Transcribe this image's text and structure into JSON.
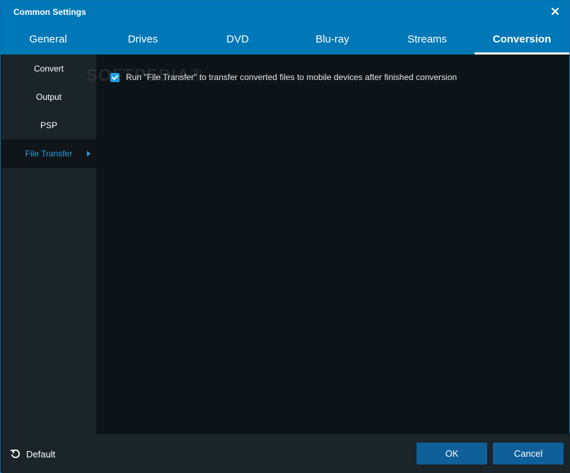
{
  "window": {
    "title": "Common Settings"
  },
  "tabs": [
    {
      "label": "General"
    },
    {
      "label": "Drives"
    },
    {
      "label": "DVD"
    },
    {
      "label": "Blu-ray"
    },
    {
      "label": "Streams"
    },
    {
      "label": "Conversion",
      "active": true
    }
  ],
  "sidebar": {
    "items": [
      {
        "label": "Convert"
      },
      {
        "label": "Output"
      },
      {
        "label": "PSP"
      },
      {
        "label": "File Transfer",
        "active": true
      }
    ]
  },
  "content": {
    "option_run_file_transfer": {
      "label": "Run \"File Transfer\" to transfer converted files to mobile devices after finished conversion",
      "checked": true
    },
    "watermark": "SOFTPEDIA®"
  },
  "footer": {
    "default_label": "Default",
    "ok_label": "OK",
    "cancel_label": "Cancel"
  },
  "colors": {
    "accent": "#0077b6",
    "active_text": "#2a9fe0",
    "button": "#0f5f98",
    "panel": "#1b2429",
    "background": "#0d1418"
  }
}
